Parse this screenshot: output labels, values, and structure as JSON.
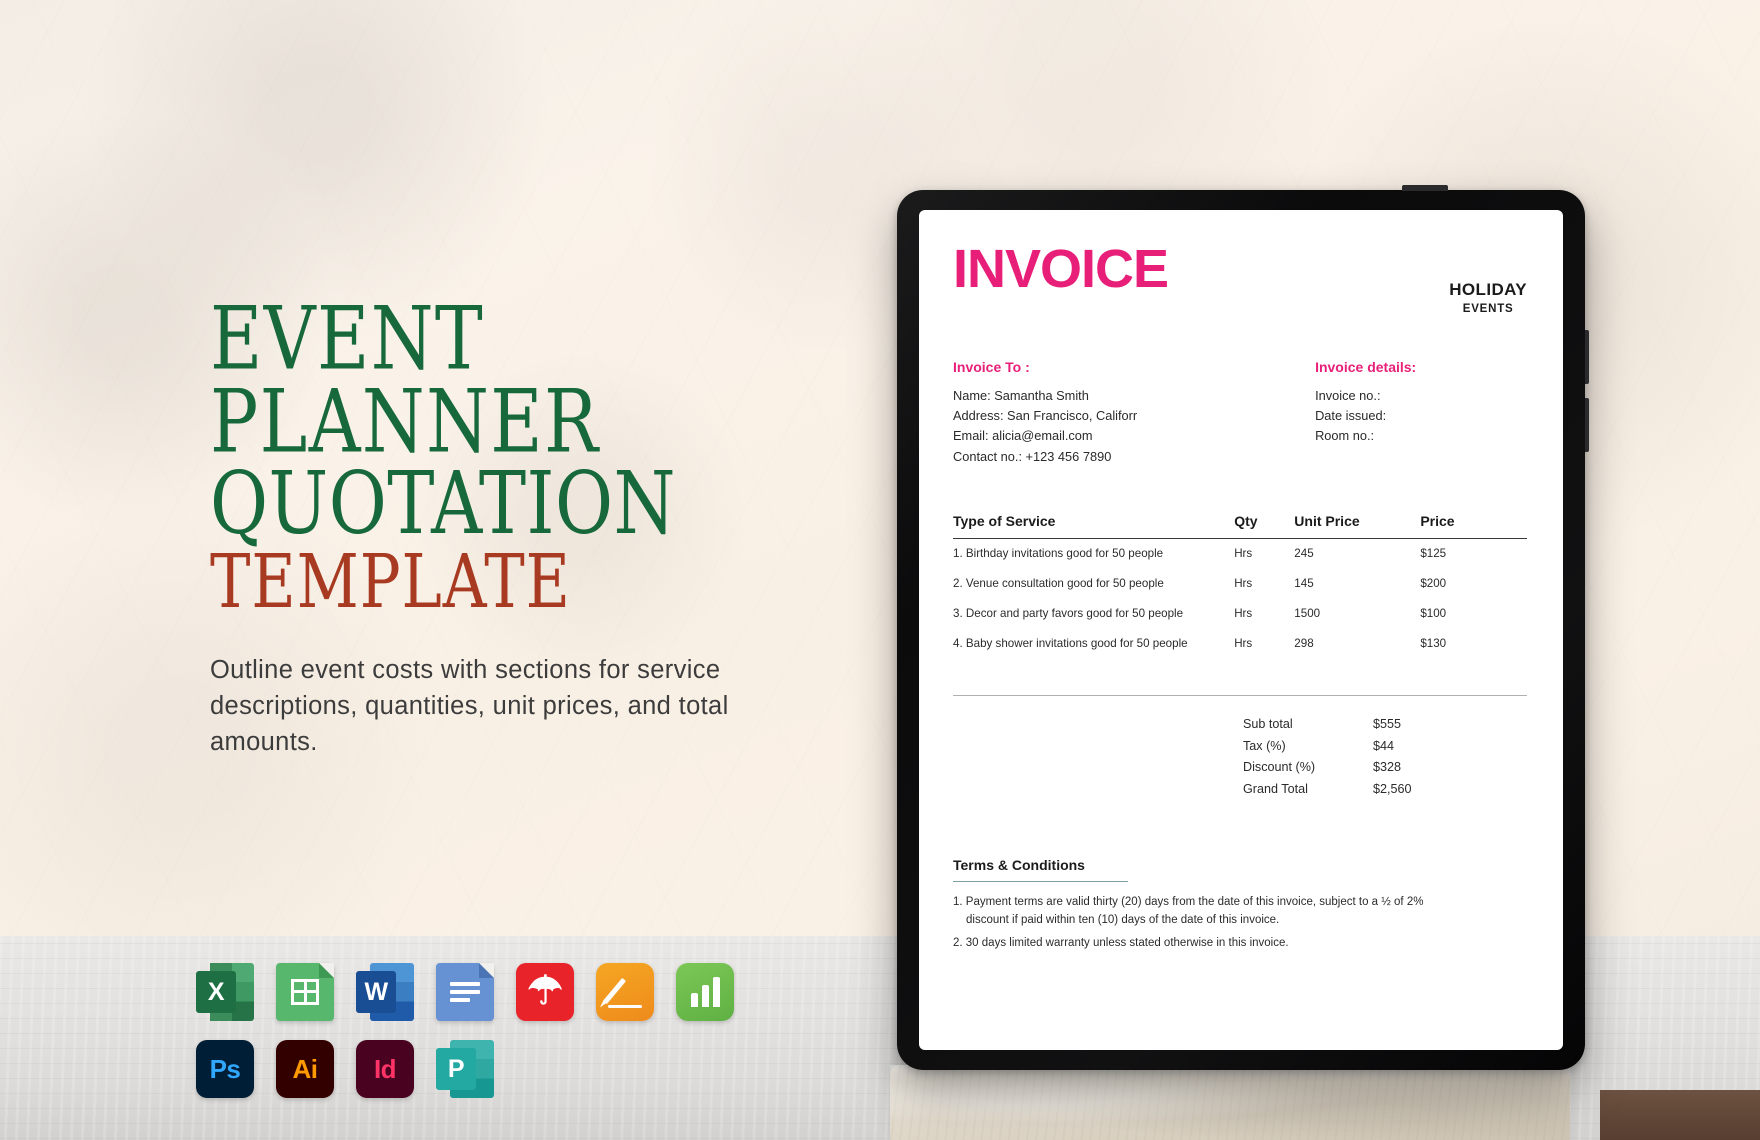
{
  "promo": {
    "title_lines": [
      "EVENT",
      "PLANNER",
      "QUOTATION"
    ],
    "title_accent": "TEMPLATE",
    "description": "Outline event costs with sections for service descriptions, quantities, unit prices, and total amounts.",
    "colors": {
      "title_green": "#17693C",
      "accent_rust": "#A93A22",
      "invoice_pink": "#E81F79"
    }
  },
  "formats": {
    "row1": [
      {
        "name": "microsoft-excel",
        "label": "X"
      },
      {
        "name": "google-sheets",
        "label": ""
      },
      {
        "name": "microsoft-word",
        "label": "W"
      },
      {
        "name": "google-docs",
        "label": ""
      },
      {
        "name": "adobe-pdf",
        "label": ""
      },
      {
        "name": "apple-pages",
        "label": ""
      },
      {
        "name": "apple-numbers",
        "label": ""
      }
    ],
    "row2": [
      {
        "name": "adobe-photoshop",
        "label": "Ps"
      },
      {
        "name": "adobe-illustrator",
        "label": "Ai"
      },
      {
        "name": "adobe-indesign",
        "label": "Id"
      },
      {
        "name": "microsoft-publisher",
        "label": "P"
      }
    ]
  },
  "invoice": {
    "title": "INVOICE",
    "brand": {
      "line1": "HOLIDAY",
      "line2": "EVENTS"
    },
    "bill_to": {
      "heading": "Invoice To :",
      "lines": [
        "Name: Samantha Smith",
        "Address: San Francisco, Califorr",
        "Email: alicia@email.com",
        "Contact no.: +123 456 7890"
      ]
    },
    "details": {
      "heading": "Invoice details:",
      "lines": [
        "Invoice no.:",
        "Date issued:",
        "Room no.:"
      ]
    },
    "table": {
      "columns": [
        "Type of Service",
        "Qty",
        "Unit Price",
        "Price"
      ],
      "rows": [
        {
          "service": "1. Birthday invitations good for 50 people",
          "qty": "Hrs",
          "unit": "245",
          "price": "$125"
        },
        {
          "service": "2. Venue consultation good for 50 people",
          "qty": "Hrs",
          "unit": "145",
          "price": "$200"
        },
        {
          "service": "3. Decor and party favors good for 50 people",
          "qty": "Hrs",
          "unit": "1500",
          "price": "$100"
        },
        {
          "service": "4. Baby shower invitations good for 50 people",
          "qty": "Hrs",
          "unit": "298",
          "price": "$130"
        }
      ]
    },
    "totals": [
      {
        "label": "Sub total",
        "value": "$555"
      },
      {
        "label": "Tax (%)",
        "value": "$44"
      },
      {
        "label": "Discount (%)",
        "value": "$328"
      },
      {
        "label": "Grand Total",
        "value": "$2,560"
      }
    ],
    "terms": {
      "heading": "Terms & Conditions",
      "items": [
        {
          "text": "1. Payment terms are valid thirty (20) days from the date of this invoice, subject to a ½ of 2%",
          "cont": "discount if paid within ten (10) days of the date of this invoice."
        },
        {
          "text": "2. 30 days limited warranty unless stated otherwise in this invoice.",
          "cont": ""
        }
      ]
    }
  }
}
